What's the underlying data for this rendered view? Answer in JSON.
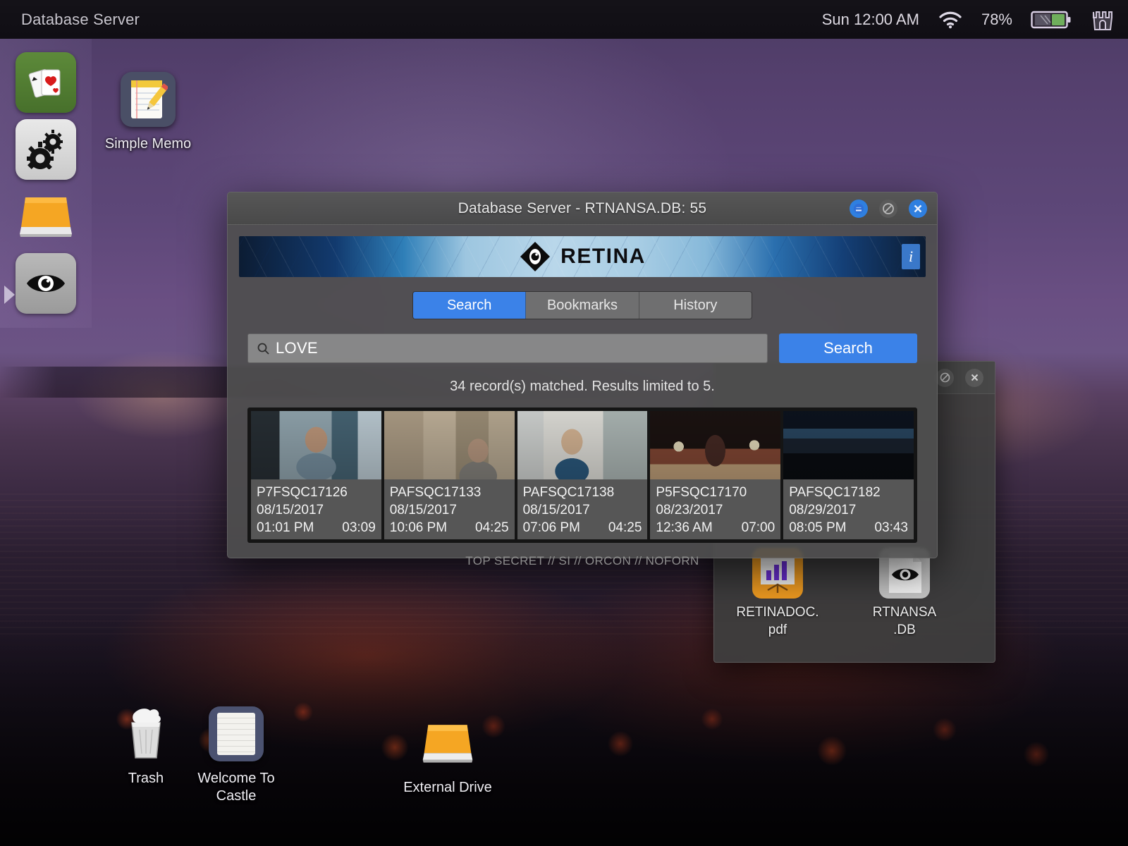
{
  "statusbar": {
    "title": "Database Server",
    "clock": "Sun 12:00 AM",
    "battery_percent": "78%",
    "wifi_icon": "wifi-icon",
    "battery_icon": "battery-icon",
    "castle_icon": "castle-icon"
  },
  "dock": {
    "items": [
      {
        "name": "cards-icon",
        "label": "Solitaire"
      },
      {
        "name": "gears-icon",
        "label": "Settings"
      },
      {
        "name": "drive-icon",
        "label": "External Drive"
      },
      {
        "name": "eye-icon",
        "label": "Retina"
      }
    ],
    "expand_arrow": "chevron-right-icon"
  },
  "desktop_icons": [
    {
      "label": "Simple Memo",
      "icon": "memo-icon"
    },
    {
      "label": "Trash",
      "icon": "trash-icon"
    },
    {
      "label": "Welcome To Castle",
      "icon": "note-icon"
    },
    {
      "label": "External Drive",
      "icon": "drive-icon"
    }
  ],
  "background_window": {
    "files": [
      {
        "label": "RETINADOC.\npdf",
        "icon": "pdf-chart-icon"
      },
      {
        "label": "RTNANSA\n.DB",
        "icon": "eye-document-icon"
      }
    ],
    "controls": {
      "maximize": "maximize-icon",
      "close": "close-icon"
    }
  },
  "window": {
    "title": "Database Server - RTNANSA.DB: 55",
    "controls": {
      "minimize_label": "–",
      "maximize_label": "⧉",
      "close_label": "✕"
    },
    "banner": {
      "brand": "RETINA",
      "logo_icon": "eye-logo-icon",
      "info_label": "i"
    },
    "tabs": [
      {
        "label": "Search",
        "active": true
      },
      {
        "label": "Bookmarks",
        "active": false
      },
      {
        "label": "History",
        "active": false
      }
    ],
    "search": {
      "value": "LOVE",
      "placeholder": "Search",
      "icon": "search-icon",
      "button_label": "Search"
    },
    "result_info": "34 record(s) matched. Results limited to 5.",
    "results": [
      {
        "id": "P7FSQC17126",
        "date": "08/15/2017",
        "time": "01:01 PM",
        "duration": "03:09"
      },
      {
        "id": "PAFSQC17133",
        "date": "08/15/2017",
        "time": "10:06 PM",
        "duration": "04:25"
      },
      {
        "id": "PAFSQC17138",
        "date": "08/15/2017",
        "time": "07:06 PM",
        "duration": "04:25"
      },
      {
        "id": "P5FSQC17170",
        "date": "08/23/2017",
        "time": "12:36 AM",
        "duration": "07:00"
      },
      {
        "id": "PAFSQC17182",
        "date": "08/29/2017",
        "time": "08:05 PM",
        "duration": "03:43"
      }
    ],
    "classification": "TOP SECRET // SI // ORCON // NOFORN"
  },
  "colors": {
    "accent_blue": "#3b82e8",
    "window_gray": "#4e4e4e",
    "banner_light": "#b9d7ea",
    "drive_orange": "#f5a623"
  }
}
